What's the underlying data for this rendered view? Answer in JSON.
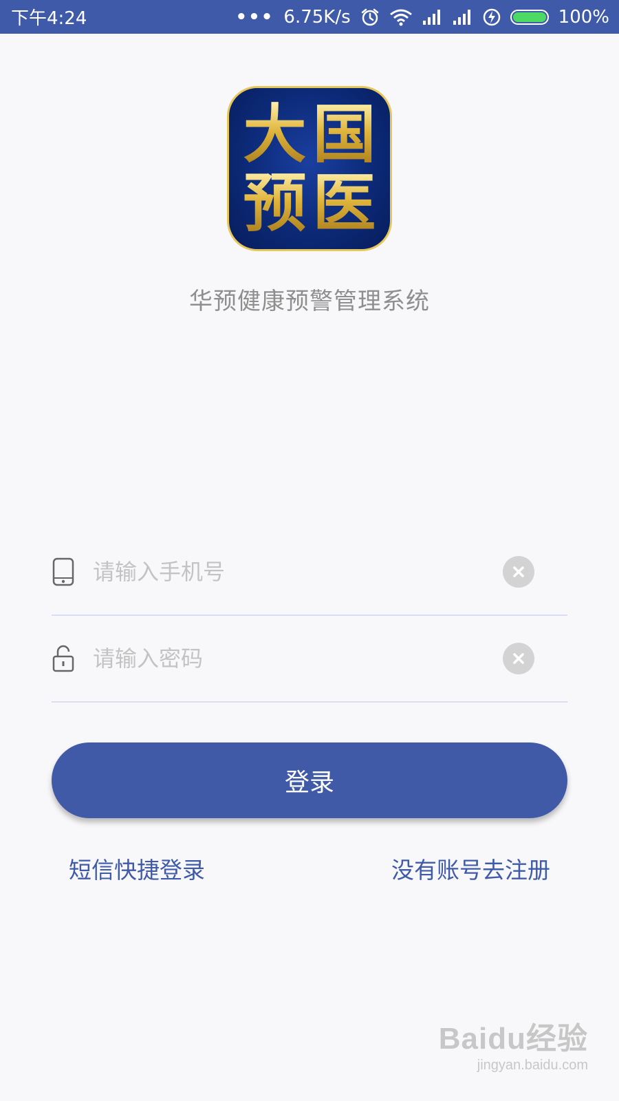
{
  "status_bar": {
    "time": "下午4:24",
    "dots": "•••",
    "network_speed": "6.75K/s",
    "battery_percent": "100%",
    "icons": [
      "alarm-icon",
      "wifi-icon",
      "signal-icon",
      "signal-icon",
      "charging-icon",
      "battery-icon"
    ],
    "battery_level": 1.0
  },
  "logo": {
    "chars": [
      "大",
      "国",
      "预",
      "医"
    ],
    "colors": {
      "background": "#0c2a78",
      "gold": "#e6c24d"
    }
  },
  "app": {
    "title": "华预健康预警管理系统"
  },
  "form": {
    "phone": {
      "placeholder": "请输入手机号",
      "value": "",
      "icon": "phone-icon"
    },
    "password": {
      "placeholder": "请输入密码",
      "value": "",
      "icon": "unlock-icon"
    },
    "clear_icon": "clear-icon",
    "login_label": "登录"
  },
  "links": {
    "sms_login": "短信快捷登录",
    "register": "没有账号去注册"
  },
  "watermark": {
    "brand": "Baidu经验",
    "url": "jingyan.baidu.com"
  },
  "colors": {
    "primary": "#405aa8",
    "background": "#f8f8fa",
    "placeholder": "#c3c3c3",
    "divider": "#d9dcf2"
  }
}
